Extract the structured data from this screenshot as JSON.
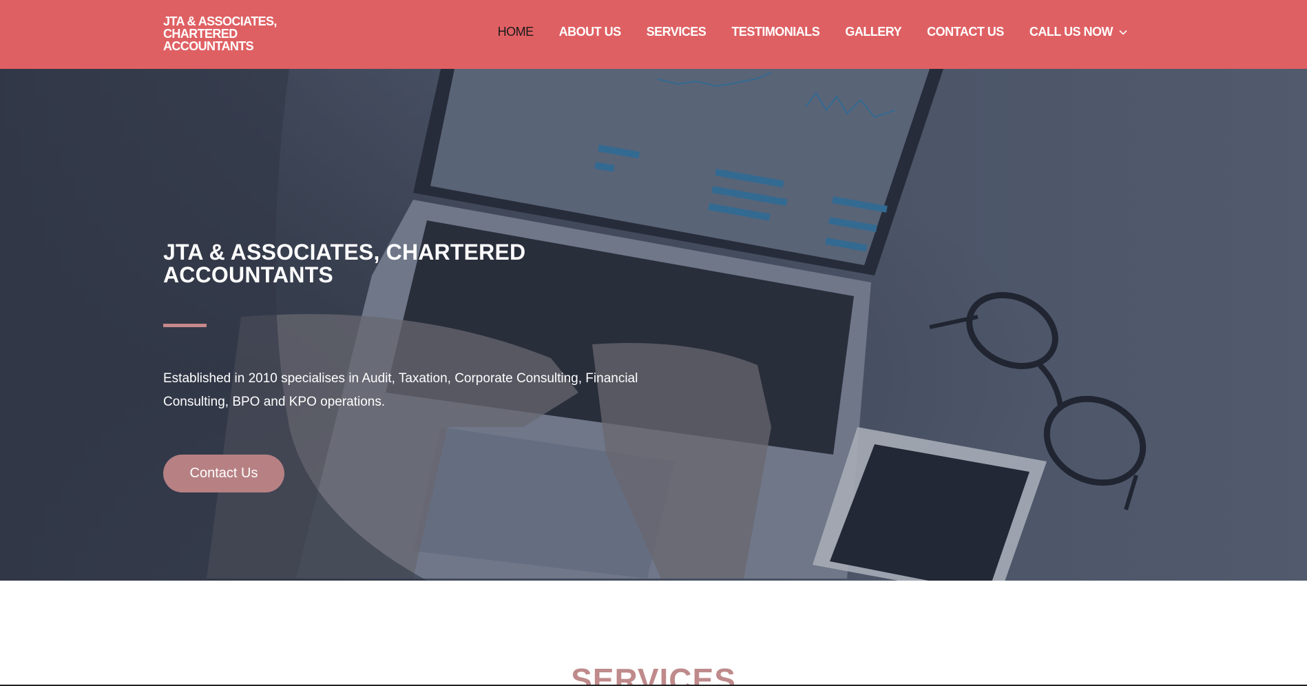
{
  "header": {
    "logo_text": "JTA & ASSOCIATES, CHARTERED ACCOUNTANTS",
    "nav": [
      {
        "label": "HOME",
        "active": true
      },
      {
        "label": "ABOUT US"
      },
      {
        "label": "SERVICES"
      },
      {
        "label": "TESTIMONIALS"
      },
      {
        "label": "GALLERY"
      },
      {
        "label": "CONTACT US"
      },
      {
        "label": "CALL US NOW",
        "icon": "chevron-down-icon"
      }
    ]
  },
  "hero": {
    "title": "JTA & ASSOCIATES, CHARTERED ACCOUNTANTS",
    "description": "Established in 2010 specialises in Audit, Taxation, Corporate Consulting, Financial Consulting, BPO and KPO operations.",
    "cta_label": "Contact Us"
  },
  "services": {
    "heading": "SERVICES"
  },
  "colors": {
    "header_bg": "#df6063",
    "accent": "#b78184",
    "heading_accent": "#bf8a8b",
    "hero_overlay": "#3d4658"
  }
}
